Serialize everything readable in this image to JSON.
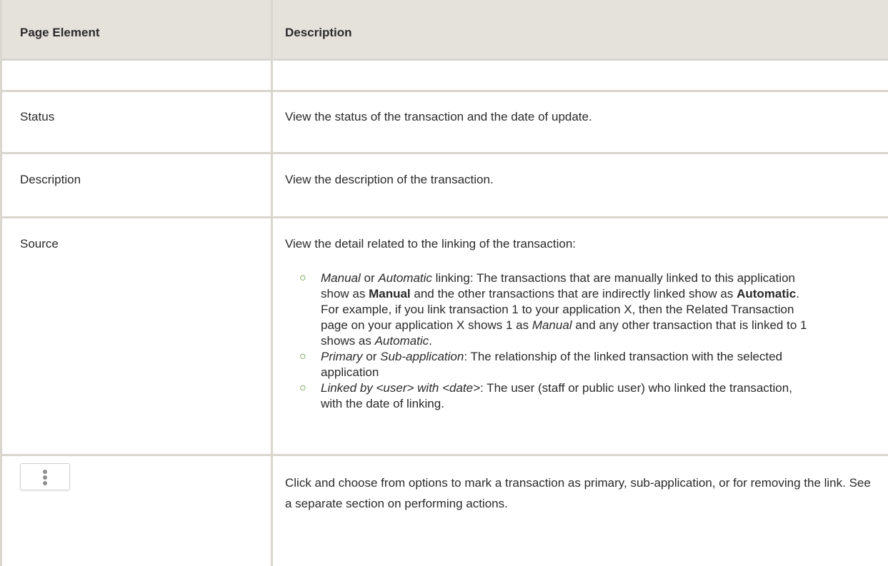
{
  "header": {
    "col1": "Page Element",
    "col2": "Description"
  },
  "rows": {
    "status": {
      "label": "Status",
      "desc": "View the status of the transaction and the date of update."
    },
    "description": {
      "label": "Description",
      "desc": "View the description of the transaction."
    },
    "source": {
      "label": "Source",
      "desc": "View the detail related to the linking of the transaction:",
      "items": {
        "manual": {
          "t1": "Manual",
          "t2": " or ",
          "t3": "Automatic",
          "t4": " linking: The transactions that are manually linked to this application show as ",
          "t5": "Manual",
          "t6": " and the other transactions that are indirectly linked show as ",
          "t7": "Automatic",
          "t8": ". For example, if you link transaction 1 to your application X, then the Related Transaction page on your application X shows 1 as ",
          "t9": "Manual",
          "t10": " and any other transaction that is linked to 1 shows as ",
          "t11": "Automatic",
          "t12": "."
        },
        "primary": {
          "t1": "Primary",
          "t2": " or ",
          "t3": "Sub-application",
          "t4": ": The relationship of the linked transaction with the selected application"
        },
        "linked": {
          "t1": "Linked by <user> with <date>",
          "t2": ": The user (staff or public user) who linked the transaction, with the date of linking."
        }
      }
    },
    "actions": {
      "desc": "Click and choose from options to mark a transaction as primary, sub-application, or for removing the link. See a separate section on performing actions."
    }
  },
  "icons": {
    "actions": "more-vertical-icon",
    "bullet": "circle-bullet-icon"
  },
  "colors": {
    "header_bg": "#e5e2dc",
    "border": "#d9d6d0",
    "bullet": "#4a8a2a"
  }
}
